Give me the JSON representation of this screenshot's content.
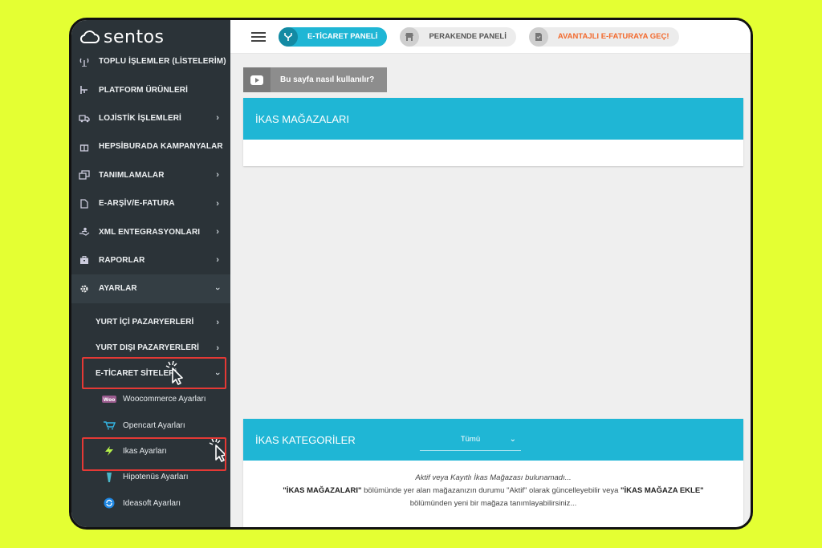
{
  "brand": {
    "name": "sentos"
  },
  "sidebar": {
    "items": [
      {
        "label": "TOPLU İŞLEMLER (LİSTELERİM)",
        "icon": "antenna-icon",
        "chevron": false
      },
      {
        "label": "PLATFORM ÜRÜNLERİ",
        "icon": "hierarchy-icon",
        "chevron": false
      },
      {
        "label": "LOJİSTİK İŞLEMLERİ",
        "icon": "truck-icon",
        "chevron": true
      },
      {
        "label": "HEPSİBURADA KAMPANYALAR",
        "icon": "gift-icon",
        "chevron": false
      },
      {
        "label": "TANIMLAMALAR",
        "icon": "windows-icon",
        "chevron": true
      },
      {
        "label": "E-ARŞİV/E-FATURA",
        "icon": "document-icon",
        "chevron": true
      },
      {
        "label": "XML ENTEGRASYONLARI",
        "icon": "hand-icon",
        "chevron": true
      },
      {
        "label": "RAPORLAR",
        "icon": "briefcase-icon",
        "chevron": true
      },
      {
        "label": "AYARLAR",
        "icon": "gear-icon",
        "chevron": true
      }
    ],
    "sub_items": [
      {
        "label": "YURT İÇİ PAZARYERLERİ"
      },
      {
        "label": "YURT DIŞI PAZARYERLERİ"
      },
      {
        "label": "E-TİCARET SİTELERİ"
      }
    ],
    "leaf_items": [
      {
        "label": "Woocommerce Ayarları",
        "icon": "woo-icon"
      },
      {
        "label": "Opencart Ayarları",
        "icon": "cart-icon"
      },
      {
        "label": "Ikas Ayarları",
        "icon": "lightning-icon"
      },
      {
        "label": "Hipotenüs Ayarları",
        "icon": "crystal-icon"
      },
      {
        "label": "Ideasoft Ayarları",
        "icon": "refresh-circle-icon"
      }
    ]
  },
  "topbar": {
    "menu_icon": "hamburger-icon",
    "tabs": [
      {
        "label": "E-TİCARET PANELİ",
        "icon": "fork-icon"
      },
      {
        "label": "PERAKENDE PANELİ",
        "icon": "store-icon"
      },
      {
        "label": "AVANTAJLI E-FATURAYA GEÇ!",
        "icon": "invoice-icon"
      }
    ]
  },
  "main": {
    "help_button": "Bu sayfa nasıl kullanılır?",
    "stores_panel": {
      "title": "İKAS MAĞAZALARI"
    },
    "categories_panel": {
      "title": "İKAS KATEGORİLER",
      "filter_value": "Tümü",
      "empty_line1": "Aktif veya Kayıtlı İkas Mağazası bulunamadı...",
      "empty_strong1": "\"İKAS MAĞAZALARI\"",
      "empty_mid": " bölümünde yer alan mağazanızın durumu \"Aktif\" olarak güncelleyebilir veya ",
      "empty_strong2": "\"İKAS MAĞAZA EKLE\"",
      "empty_line3": "bölümünden yeni bir mağaza tanımlayabilirsiniz..."
    }
  },
  "colors": {
    "accent": "#1fb6d5",
    "sidebar": "#2b3338",
    "highlight": "#e53935",
    "promo": "#f26a2e",
    "background": "#e4ff33"
  }
}
